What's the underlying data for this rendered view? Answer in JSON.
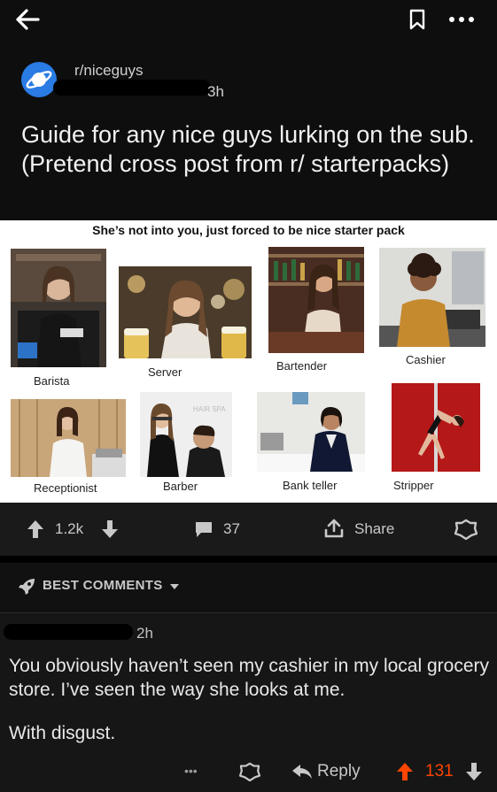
{
  "post": {
    "subreddit": "r/niceguys",
    "time": "3h",
    "title": "Guide for any nice guys lurking on the sub. (Pretend cross post from r/ starterpacks)"
  },
  "image": {
    "title": "She’s not into you, just forced to be nice starter pack",
    "captions": {
      "barista": "Barista",
      "server": "Server",
      "bartender": "Bartender",
      "cashier": "Cashier",
      "receptionist": "Receptionist",
      "barber": "Barber",
      "bank_teller": "Bank teller",
      "stripper": "Stripper"
    },
    "hair_sign": "HAIR SPA"
  },
  "actions": {
    "score": "1.2k",
    "comments": "37",
    "share": "Share"
  },
  "sort": {
    "label": "BEST COMMENTS"
  },
  "comment": {
    "time": "2h",
    "body": "You obviously haven’t seen my cashier in my local grocery store. I’ve seen the way she looks at me.",
    "body2": "With disgust.",
    "reply": "Reply",
    "score": "131",
    "more": "•••"
  },
  "colors": {
    "background": "#0e0e0e",
    "accent_orange": "#ff4500",
    "subreddit_icon": "#2a7be4"
  }
}
